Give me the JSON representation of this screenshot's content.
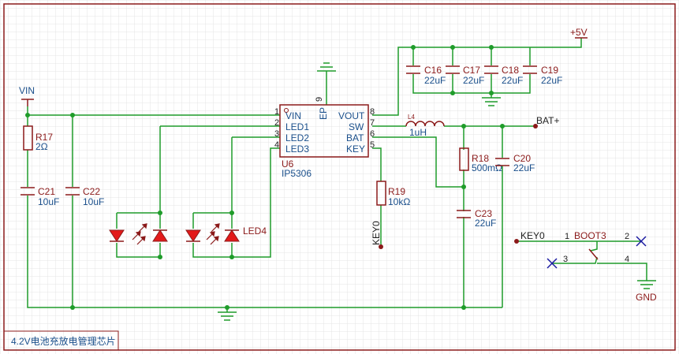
{
  "colors": {
    "wire": "#1f9c2a",
    "symbol": "#8b1a1a",
    "led_fill": "#e31a1a",
    "grid": "#e4e4e4",
    "frame": "#8b1a1a",
    "label_blue": "#1a4f8b"
  },
  "nets": {
    "vin": "VIN",
    "vplus": "+5V",
    "bat_plus": "BAT+",
    "key0_top": "KEY0",
    "key0_left": "KEY0",
    "gnd": "GND"
  },
  "ic": {
    "designator": "U6",
    "part": "IP5306",
    "pins_left": [
      {
        "num": "1",
        "name": "VIN"
      },
      {
        "num": "2",
        "name": "LED1"
      },
      {
        "num": "3",
        "name": "LED2"
      },
      {
        "num": "4",
        "name": "LED3"
      }
    ],
    "pins_right": [
      {
        "num": "8",
        "name": "VOUT"
      },
      {
        "num": "7",
        "name": "SW"
      },
      {
        "num": "6",
        "name": "BAT"
      },
      {
        "num": "5",
        "name": "KEY"
      }
    ],
    "pin_top": {
      "num": "9",
      "name": "EP"
    }
  },
  "components": {
    "r17": {
      "ref": "R17",
      "value": "2Ω"
    },
    "c21": {
      "ref": "C21",
      "value": "10uF"
    },
    "c22": {
      "ref": "C22",
      "value": "10uF"
    },
    "led4": {
      "ref": "LED4"
    },
    "r19": {
      "ref": "R19",
      "value": "10kΩ"
    },
    "l4": {
      "ref": "L4",
      "value": "1uH"
    },
    "r18": {
      "ref": "R18",
      "value": "500mΩ"
    },
    "c20": {
      "ref": "C20",
      "value": "22uF"
    },
    "c23": {
      "ref": "C23",
      "value": "22uF"
    },
    "c16": {
      "ref": "C16",
      "value": "22uF"
    },
    "c17": {
      "ref": "C17",
      "value": "22uF"
    },
    "c18": {
      "ref": "C18",
      "value": "22uF"
    },
    "c19": {
      "ref": "C19",
      "value": "22uF"
    },
    "boot3": {
      "ref": "BOOT3",
      "pins": [
        "1",
        "2",
        "3",
        "4"
      ]
    }
  },
  "sheet_title": "4.2V电池充放电管理芯片"
}
